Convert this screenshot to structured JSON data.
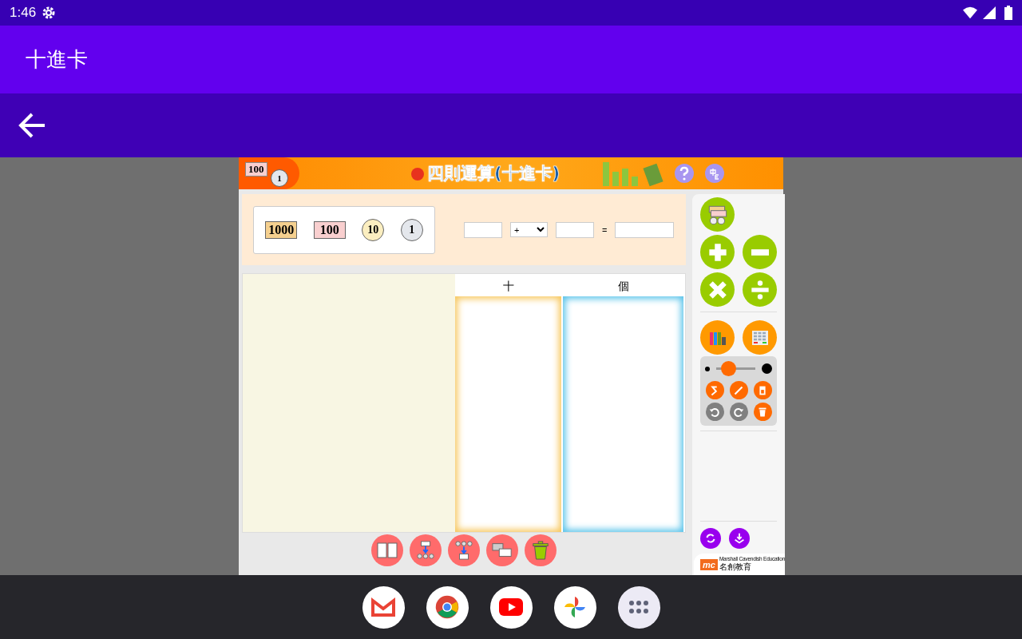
{
  "status_bar": {
    "time": "1:46"
  },
  "app_bar": {
    "title": "十進卡"
  },
  "app": {
    "header": {
      "title": "四則運算(十進卡)",
      "badge_note": "100",
      "badge_coin": "1"
    },
    "palette": [
      {
        "kind": "note",
        "value": "1000",
        "color": "#f5d08f"
      },
      {
        "kind": "note",
        "value": "100",
        "color": "#f9cfcf"
      },
      {
        "kind": "coin",
        "value": "10",
        "color": "#fbeec0"
      },
      {
        "kind": "coin",
        "value": "1",
        "color": "#e4e7ec"
      }
    ],
    "equation": {
      "operator": "+",
      "equals": "="
    },
    "columns": [
      {
        "label": "十",
        "kind": "tens"
      },
      {
        "label": "個",
        "kind": "ones"
      }
    ],
    "sidebar": {
      "pen_size": {
        "level": 0.3
      }
    },
    "logo": {
      "mark": "mc",
      "name": "Marshall Cavendish Education",
      "name_zh": "名創教育"
    }
  }
}
